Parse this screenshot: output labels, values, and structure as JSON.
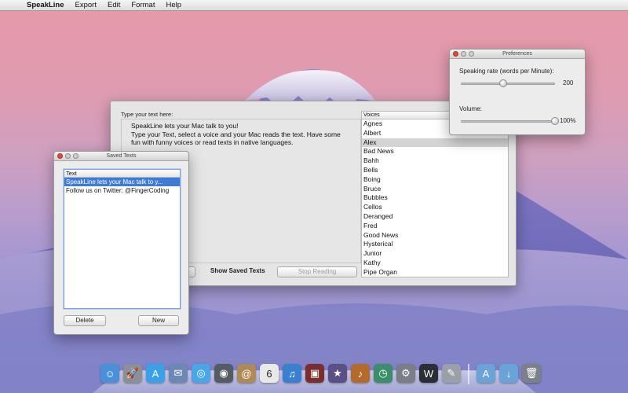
{
  "menubar": {
    "app_name": "SpeakLine",
    "items": [
      "Export",
      "Edit",
      "Format",
      "Help"
    ]
  },
  "main_window": {
    "type_label": "Type your text here:",
    "text_lines": [
      "SpeakLine lets your Mac talk to you!",
      "Type your Text, select a voice and your Mac reads the text. Have some fun with funny voices or read texts in native languages."
    ],
    "voices_header": "Voices",
    "voices": [
      "Agnes",
      "Albert",
      "Alex",
      "Bad News",
      "Bahh",
      "Bells",
      "Boing",
      "Bruce",
      "Bubbles",
      "Cellos",
      "Deranged",
      "Fred",
      "Good News",
      "Hysterical",
      "Junior",
      "Kathy",
      "Pipe Organ"
    ],
    "selected_voice": "Alex",
    "show_saved_texts_label": "Show Saved Texts",
    "stop_reading_label": "Stop Reading"
  },
  "saved_window": {
    "title": "Saved Texts",
    "list_header": "Text",
    "rows": [
      "SpeakLine lets your Mac talk to y...",
      "Follow us on Twitter: @FingerCoding"
    ],
    "delete_label": "Delete",
    "new_label": "New"
  },
  "prefs_window": {
    "title": "Preferences",
    "rate_label": "Speaking rate (words per Minute):",
    "rate_value": "200",
    "rate_fraction": 0.45,
    "volume_label": "Volume:",
    "volume_value": "100%",
    "volume_fraction": 1.0
  },
  "dock": {
    "icons": [
      {
        "name": "finder-icon",
        "glyph": "☺",
        "color": "#4a8fd9"
      },
      {
        "name": "launchpad-icon",
        "glyph": "🚀",
        "color": "#8b8f98"
      },
      {
        "name": "app-store-icon",
        "glyph": "A",
        "color": "#3aa0e8"
      },
      {
        "name": "mail-stamp-icon",
        "glyph": "✉",
        "color": "#6c88b5"
      },
      {
        "name": "safari-icon",
        "glyph": "◎",
        "color": "#4aa6e6"
      },
      {
        "name": "facetime-icon",
        "glyph": "◉",
        "color": "#555b63"
      },
      {
        "name": "contacts-icon",
        "glyph": "@",
        "color": "#b08a56"
      },
      {
        "name": "calendar-icon",
        "glyph": "6",
        "color": "#e9e9e9"
      },
      {
        "name": "itunes-icon",
        "glyph": "♫",
        "color": "#3b7fd1"
      },
      {
        "name": "photo-booth-icon",
        "glyph": "▣",
        "color": "#7a2d2d"
      },
      {
        "name": "imovie-icon",
        "glyph": "★",
        "color": "#5b4f86"
      },
      {
        "name": "garageband-icon",
        "glyph": "♪",
        "color": "#b36a2a"
      },
      {
        "name": "time-machine-icon",
        "glyph": "◷",
        "color": "#3a8e6a"
      },
      {
        "name": "system-preferences-icon",
        "glyph": "⚙",
        "color": "#7a7e86"
      },
      {
        "name": "activity-monitor-icon",
        "glyph": "W",
        "color": "#2b2f35"
      },
      {
        "name": "utilities-icon",
        "glyph": "✎",
        "color": "#9aa0a8"
      },
      {
        "name": "applications-folder-icon",
        "glyph": "A",
        "color": "#6aa3d8"
      },
      {
        "name": "downloads-folder-icon",
        "glyph": "↓",
        "color": "#6aa3d8"
      },
      {
        "name": "trash-icon",
        "glyph": "🗑",
        "color": "#7c8088"
      }
    ]
  }
}
